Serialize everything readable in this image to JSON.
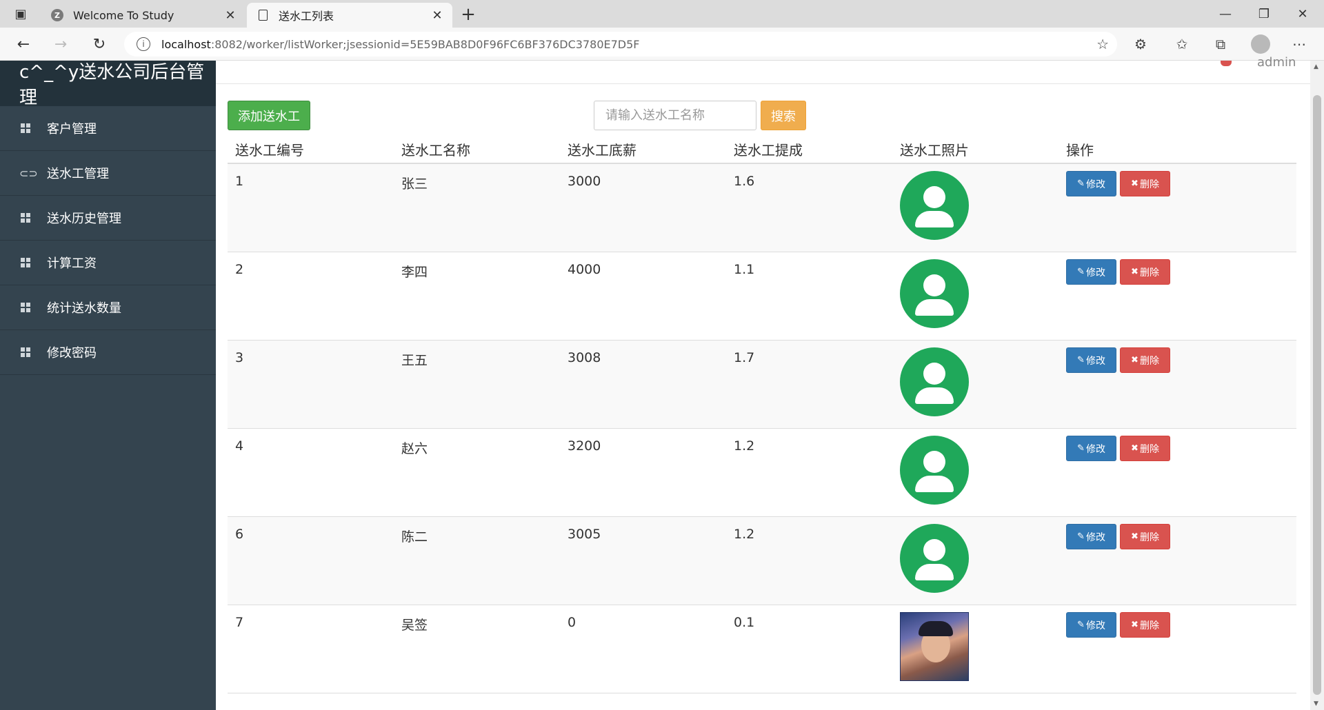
{
  "browser": {
    "tabs": [
      {
        "title": "Welcome To Study",
        "favicon": "Z"
      },
      {
        "title": "送水工列表"
      }
    ],
    "url_host": "localhost",
    "url_rest": ":8082/worker/listWorker;jsessionid=5E59BAB8D0F96FC6BF376DC3780E7D5F"
  },
  "app": {
    "brand": "c^_^y送水公司后台管理",
    "user": "admin",
    "menu": [
      {
        "label": "客户管理",
        "icon": "grid-icon"
      },
      {
        "label": "送水工管理",
        "icon": "link-icon"
      },
      {
        "label": "送水历史管理",
        "icon": "grid-icon"
      },
      {
        "label": "计算工资",
        "icon": "grid-icon"
      },
      {
        "label": "统计送水数量",
        "icon": "grid-icon"
      },
      {
        "label": "修改密码",
        "icon": "grid-icon"
      }
    ]
  },
  "toolbar": {
    "add_label": "添加送水工",
    "search_placeholder": "请输入送水工名称",
    "search_label": "搜索"
  },
  "table": {
    "headers": [
      "送水工编号",
      "送水工名称",
      "送水工底薪",
      "送水工提成",
      "送水工照片",
      "操作"
    ],
    "edit_label": "修改",
    "delete_label": "删除",
    "rows": [
      {
        "id": "1",
        "name": "张三",
        "salary": "3000",
        "commission": "1.6",
        "photo": "avatar"
      },
      {
        "id": "2",
        "name": "李四",
        "salary": "4000",
        "commission": "1.1",
        "photo": "avatar"
      },
      {
        "id": "3",
        "name": "王五",
        "salary": "3008",
        "commission": "1.7",
        "photo": "avatar"
      },
      {
        "id": "4",
        "name": "赵六",
        "salary": "3200",
        "commission": "1.2",
        "photo": "avatar"
      },
      {
        "id": "6",
        "name": "陈二",
        "salary": "3005",
        "commission": "1.2",
        "photo": "avatar"
      },
      {
        "id": "7",
        "name": "吴签",
        "salary": "0",
        "commission": "0.1",
        "photo": "picture"
      }
    ]
  },
  "colors": {
    "sidebar": "#34444f",
    "brand_bg": "#23323b",
    "success": "#4cae4c",
    "warning": "#f0ad4e",
    "primary": "#337ab7",
    "danger": "#d9534f",
    "avatar": "#1fa85a"
  }
}
